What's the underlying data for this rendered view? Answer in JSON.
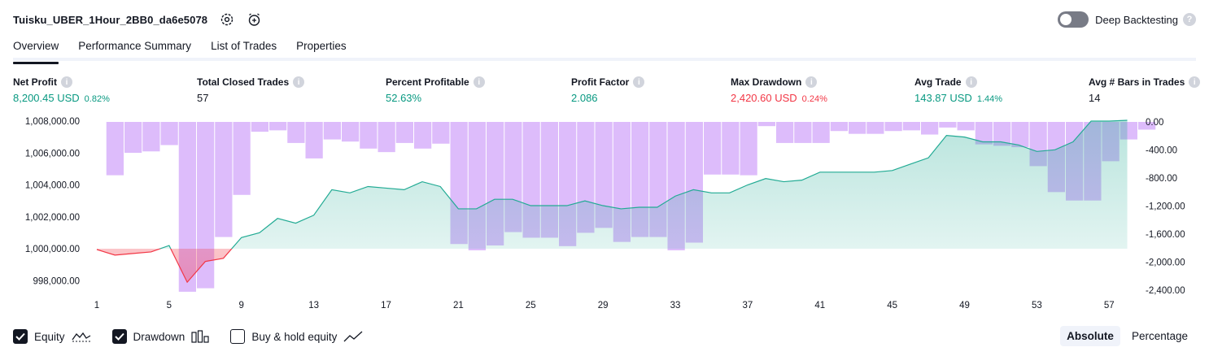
{
  "header": {
    "title": "Tuisku_UBER_1Hour_2BB0_da6e5078",
    "settings_icon": "gear-icon",
    "alert_icon": "add-alert-clock-icon"
  },
  "deep_backtesting": {
    "label": "Deep Backtesting",
    "enabled": false,
    "help": "?"
  },
  "tabs": [
    {
      "label": "Overview",
      "active": true
    },
    {
      "label": "Performance Summary",
      "active": false
    },
    {
      "label": "List of Trades",
      "active": false
    },
    {
      "label": "Properties",
      "active": false
    }
  ],
  "metrics": [
    {
      "label": "Net Profit",
      "value": "8,200.45 USD",
      "pct": "0.82%",
      "tone": "pos"
    },
    {
      "label": "Total Closed Trades",
      "value": "57",
      "pct": "",
      "tone": "neutral"
    },
    {
      "label": "Percent Profitable",
      "value": "52.63%",
      "pct": "",
      "tone": "pos"
    },
    {
      "label": "Profit Factor",
      "value": "2.086",
      "pct": "",
      "tone": "pos"
    },
    {
      "label": "Max Drawdown",
      "value": "2,420.60 USD",
      "pct": "0.24%",
      "tone": "neg"
    },
    {
      "label": "Avg Trade",
      "value": "143.87 USD",
      "pct": "1.44%",
      "tone": "pos"
    },
    {
      "label": "Avg # Bars in Trades",
      "value": "14",
      "pct": "",
      "tone": "neutral"
    }
  ],
  "chart_data": {
    "type": "line",
    "x_ticks": [
      "1",
      "5",
      "9",
      "13",
      "17",
      "21",
      "25",
      "29",
      "33",
      "37",
      "41",
      "45",
      "49",
      "53",
      "57"
    ],
    "left_axis": {
      "ticks": [
        "1,008,000.00",
        "1,006,000.00",
        "1,004,000.00",
        "1,002,000.00",
        "1,000,000.00",
        "998,000.00"
      ],
      "ylim": [
        997300,
        1008000
      ]
    },
    "right_axis": {
      "ticks": [
        "0.00",
        "-400.00",
        "-800.00",
        "-1,200.00",
        "-1,600.00",
        "-2,000.00",
        "-2,400.00"
      ],
      "ylim": [
        -2420.6,
        0
      ]
    },
    "equity": {
      "x": [
        1,
        2,
        3,
        4,
        5,
        6,
        7,
        8,
        9,
        10,
        11,
        12,
        13,
        14,
        15,
        16,
        17,
        18,
        19,
        20,
        21,
        22,
        23,
        24,
        25,
        26,
        27,
        28,
        29,
        30,
        31,
        32,
        33,
        34,
        35,
        36,
        37,
        38,
        39,
        40,
        41,
        42,
        43,
        44,
        45,
        46,
        47,
        48,
        49,
        50,
        51,
        52,
        53,
        54,
        55,
        56,
        57,
        58
      ],
      "values": [
        999950,
        999600,
        999700,
        999800,
        1000200,
        997900,
        999200,
        999400,
        1000700,
        1001000,
        1001900,
        1001600,
        1002100,
        1003700,
        1003500,
        1003900,
        1003800,
        1003700,
        1004200,
        1003900,
        1002500,
        1002500,
        1003100,
        1003100,
        1002700,
        1002700,
        1002700,
        1003000,
        1002700,
        1002500,
        1002600,
        1002600,
        1003300,
        1003700,
        1003500,
        1003500,
        1004000,
        1004400,
        1004200,
        1004300,
        1004800,
        1004800,
        1004800,
        1004800,
        1004900,
        1005300,
        1005700,
        1007100,
        1007000,
        1006700,
        1006700,
        1006500,
        1006100,
        1006200,
        1006700,
        1008000,
        1008000,
        1008050
      ],
      "baseline": 1000000,
      "colors": {
        "up_line": "#22ab94",
        "down_line": "#f23645",
        "up_fill": "#daf1ea",
        "down_fill": "#fde0e4"
      }
    },
    "drawdown": {
      "values": [
        0,
        -760,
        -440,
        -420,
        -330,
        -2420,
        -2370,
        -1640,
        -1040,
        -140,
        -120,
        -300,
        -520,
        -250,
        -280,
        -380,
        -430,
        -300,
        -380,
        -310,
        -1740,
        -1830,
        -1760,
        -1570,
        -1650,
        -1650,
        -1770,
        -1580,
        -1510,
        -1710,
        -1640,
        -1640,
        -1830,
        -1720,
        -750,
        -750,
        -760,
        -60,
        -300,
        -300,
        -300,
        -130,
        -170,
        -170,
        -130,
        -120,
        -180,
        -80,
        -120,
        -320,
        -340,
        -360,
        -630,
        -1000,
        -1120,
        -1120,
        -560,
        -250,
        -110
      ],
      "color": "#ddbcfb"
    },
    "legend": [
      {
        "label": "Equity",
        "checked": true,
        "icon": "equity-line-icon"
      },
      {
        "label": "Drawdown",
        "checked": true,
        "icon": "drawdown-bars-icon"
      },
      {
        "label": "Buy & hold equity",
        "checked": false,
        "icon": "buy-hold-line-icon"
      }
    ],
    "modes": [
      {
        "label": "Absolute",
        "active": true
      },
      {
        "label": "Percentage",
        "active": false
      }
    ]
  }
}
